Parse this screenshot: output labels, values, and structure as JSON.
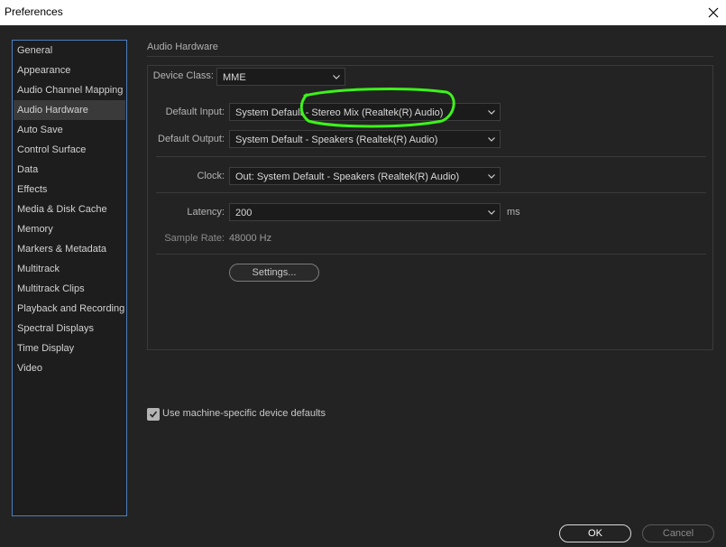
{
  "window": {
    "title": "Preferences",
    "close_icon": "close-icon"
  },
  "sidebar": {
    "items": [
      {
        "label": "General"
      },
      {
        "label": "Appearance"
      },
      {
        "label": "Audio Channel Mapping"
      },
      {
        "label": "Audio Hardware",
        "selected": true
      },
      {
        "label": "Auto Save"
      },
      {
        "label": "Control Surface"
      },
      {
        "label": "Data"
      },
      {
        "label": "Effects"
      },
      {
        "label": "Media & Disk Cache"
      },
      {
        "label": "Memory"
      },
      {
        "label": "Markers & Metadata"
      },
      {
        "label": "Multitrack"
      },
      {
        "label": "Multitrack Clips"
      },
      {
        "label": "Playback and Recording"
      },
      {
        "label": "Spectral Displays"
      },
      {
        "label": "Time Display"
      },
      {
        "label": "Video"
      }
    ]
  },
  "section": {
    "title": "Audio Hardware"
  },
  "device_class": {
    "label": "Device Class:",
    "value": "MME"
  },
  "default_input": {
    "label": "Default Input:",
    "value": "System Default - Stereo Mix (Realtek(R) Audio)"
  },
  "default_output": {
    "label": "Default Output:",
    "value": "System Default - Speakers (Realtek(R) Audio)"
  },
  "clock": {
    "label": "Clock:",
    "value": "Out: System Default - Speakers (Realtek(R) Audio)"
  },
  "latency": {
    "label": "Latency:",
    "value": "200",
    "unit": "ms"
  },
  "sample_rate": {
    "label": "Sample Rate:",
    "value": "48000 Hz"
  },
  "buttons": {
    "settings": "Settings...",
    "ok": "OK",
    "cancel": "Cancel"
  },
  "machine_defaults": {
    "label": "Use machine-specific device defaults",
    "checked": true
  },
  "colors": {
    "accent_border": "#4b7fc0",
    "annotation": "#3df21b"
  }
}
